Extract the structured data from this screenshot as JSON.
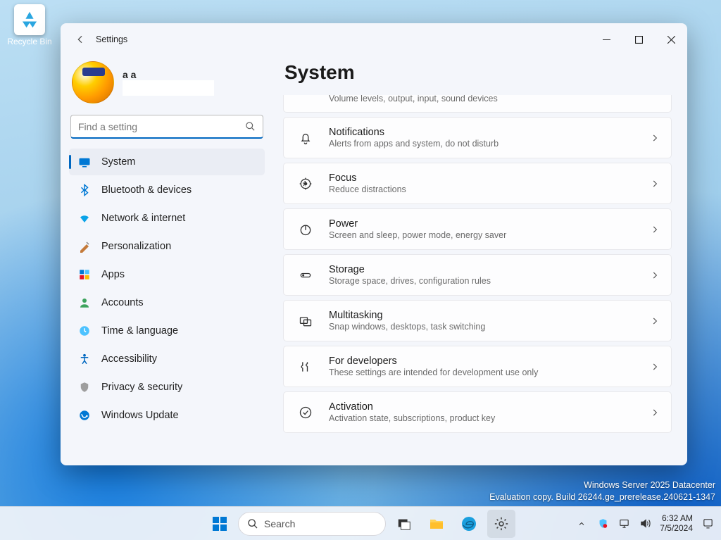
{
  "desktop": {
    "recycle_bin": "Recycle Bin"
  },
  "window": {
    "app_title": "Settings",
    "user_name": "a a",
    "search_placeholder": "Find a setting",
    "page_heading": "System"
  },
  "sidebar": {
    "items": [
      {
        "id": "system",
        "label": "System",
        "selected": true
      },
      {
        "id": "bluetooth",
        "label": "Bluetooth & devices"
      },
      {
        "id": "network",
        "label": "Network & internet"
      },
      {
        "id": "personalization",
        "label": "Personalization"
      },
      {
        "id": "apps",
        "label": "Apps"
      },
      {
        "id": "accounts",
        "label": "Accounts"
      },
      {
        "id": "time",
        "label": "Time & language"
      },
      {
        "id": "accessibility",
        "label": "Accessibility"
      },
      {
        "id": "privacy",
        "label": "Privacy & security"
      },
      {
        "id": "update",
        "label": "Windows Update"
      }
    ]
  },
  "cards": [
    {
      "id": "sound_partial",
      "title": "",
      "subtitle": "Volume levels, output, input, sound devices",
      "partial": true
    },
    {
      "id": "notifications",
      "title": "Notifications",
      "subtitle": "Alerts from apps and system, do not disturb"
    },
    {
      "id": "focus",
      "title": "Focus",
      "subtitle": "Reduce distractions"
    },
    {
      "id": "power",
      "title": "Power",
      "subtitle": "Screen and sleep, power mode, energy saver"
    },
    {
      "id": "storage",
      "title": "Storage",
      "subtitle": "Storage space, drives, configuration rules"
    },
    {
      "id": "multitasking",
      "title": "Multitasking",
      "subtitle": "Snap windows, desktops, task switching"
    },
    {
      "id": "developers",
      "title": "For developers",
      "subtitle": "These settings are intended for development use only"
    },
    {
      "id": "activation",
      "title": "Activation",
      "subtitle": "Activation state, subscriptions, product key"
    }
  ],
  "watermark": {
    "line1": "Windows Server 2025 Datacenter",
    "line2": "Evaluation copy. Build 26244.ge_prerelease.240621-1347"
  },
  "taskbar": {
    "search_label": "Search",
    "time": "6:32 AM",
    "date": "7/5/2024"
  }
}
